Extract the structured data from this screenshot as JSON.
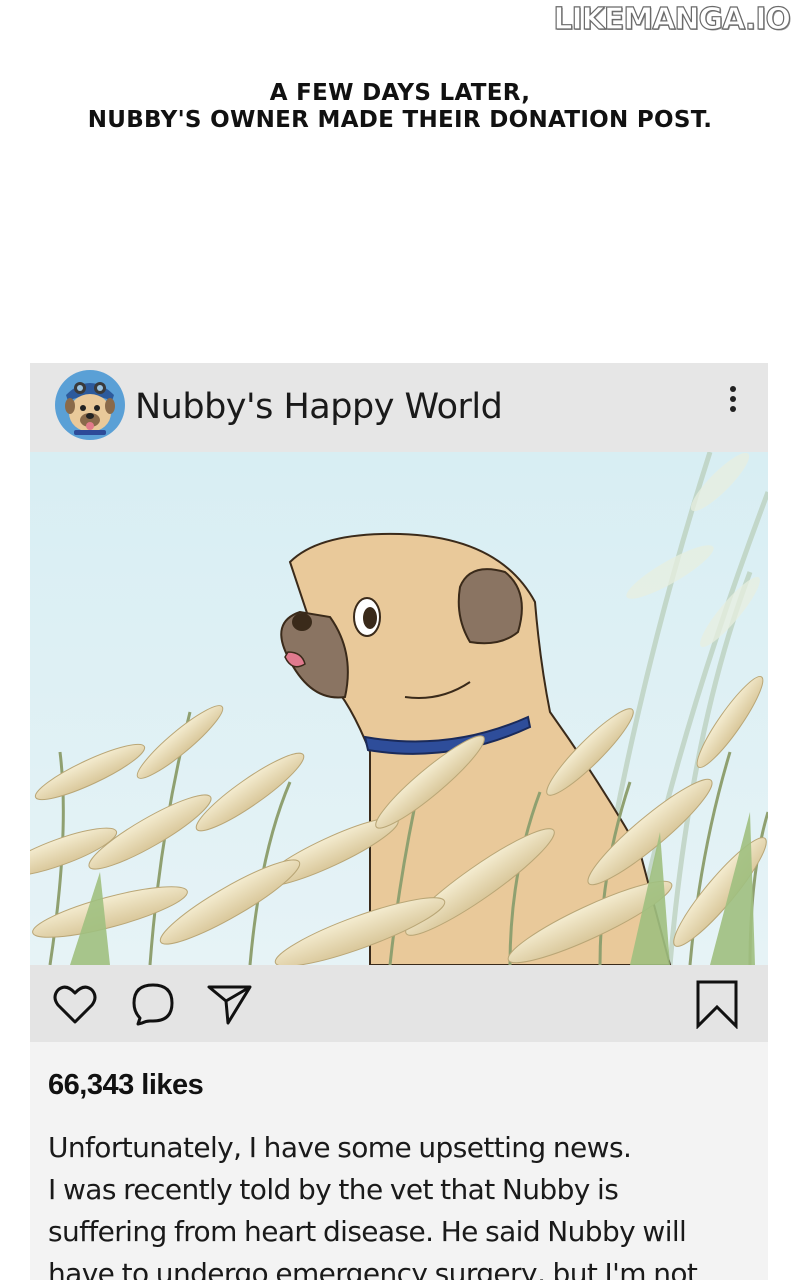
{
  "watermark": "LIKEMANGA.IO",
  "narration": {
    "line1": "A few days later,",
    "line2": "Nubby's owner made their donation post."
  },
  "post": {
    "account_name": "Nubby's Happy World",
    "likes": "66,343 likes",
    "caption_lines": [
      "Unfortunately, I have some upsetting news.",
      "I was recently told by the vet that Nubby is",
      "suffering from heart disease. He said Nubby will",
      "have to undergo emergency surgery, but I'm not"
    ]
  },
  "icons": [
    "avatar",
    "more-vertical-icon",
    "heart-icon",
    "comment-icon",
    "send-icon",
    "bookmark-icon"
  ],
  "colors": {
    "header_bg": "#e6e6e6",
    "body_bg": "#f3f3f3",
    "sky": "#dff0f4",
    "collar": "#2e4d9a"
  }
}
